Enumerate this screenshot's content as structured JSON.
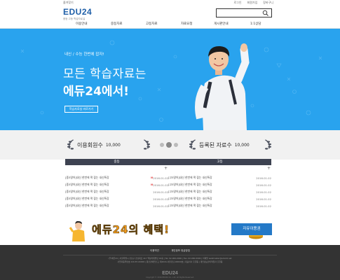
{
  "util": {
    "left": "즐겨찾기",
    "links": [
      "로그인",
      "회원가입",
      "장바구니"
    ]
  },
  "brand": {
    "logo": "EDU24",
    "tagline": "중등 고등 학습자료실",
    "accent": "#29a3ee",
    "dark": "#3d4251"
  },
  "search": {
    "placeholder": "",
    "icon": "search-icon"
  },
  "nav": {
    "items": [
      "이용안내",
      "중등자료",
      "고등자료",
      "자료요청",
      "게시판안내",
      "1:1상담"
    ]
  },
  "hero": {
    "tag": "내신 / 수능 한번에 잡자!",
    "line1": "모든 학습자료는",
    "line2": "에듀24에서!",
    "button": "학습자료실 바로가기"
  },
  "stats": {
    "members_label": "이용회원수",
    "members_value": "10,000",
    "docs_label": "등록된 자료수",
    "docs_value": "10,000"
  },
  "boards": {
    "left": {
      "title": "중등",
      "plus": "+",
      "rows": [
        {
          "title": "[중3영어]내신 한번에 꽉 잡는 내신특강",
          "new": true,
          "date": "2016.01.02"
        },
        {
          "title": "[중3영어]내신 한번에 꽉 잡는 내신특강",
          "new": true,
          "date": "2016.01.02"
        },
        {
          "title": "[중3영어]내신 한번에 꽉 잡는 내신특강",
          "new": false,
          "date": "2016.01.02"
        },
        {
          "title": "[중3영어]내신 한번에 꽉 잡는 내신특강",
          "new": false,
          "date": "2016.01.02"
        },
        {
          "title": "[중3영어]내신 한번에 꽉 잡는 내신특강",
          "new": false,
          "date": "2016.01.02"
        }
      ]
    },
    "right": {
      "title": "고등",
      "plus": "+",
      "rows": [
        {
          "title": "[고3영어]내신 한번에 꽉 잡는 내신특강",
          "new": false,
          "date": "2016.01.02"
        },
        {
          "title": "[고3영어]내신 한번에 꽉 잡는 내신특강",
          "new": false,
          "date": "2016.01.02"
        },
        {
          "title": "[고3영어]내신 한번에 꽉 잡는 내신특강",
          "new": false,
          "date": "2016.01.02"
        },
        {
          "title": "[고3영어]내신 한번에 꽉 잡는 내신특강",
          "new": false,
          "date": "2016.01.02"
        },
        {
          "title": "[고3영어]내신 한번에 꽉 잡는 내신특강",
          "new": false,
          "date": "2016.01.02"
        }
      ]
    }
  },
  "banner": {
    "text": "에듀24의 혜택!",
    "button": "자유이용권"
  },
  "footer": {
    "links": [
      "이용약관",
      "개인정보 취급방침"
    ],
    "info1": "(주)에듀24 | 서울특별시 강남구 강남대로 417 역삼타워빌딩 16층 | Tel. 02-000-0000 | Fax. 02-000-0000 | 이메일 webmaster@edu24.net",
    "info2": "사업자등록번호 220-87-00000 | 통신판매업신고 제2016-서울강남-00000호 | 대표이사 홍길동 | 개인정보관리책임자 홍길동",
    "logo": "EDU24",
    "copyright": "Copyright © 2016 EDU24 Co., Ltd. All Rights Reserved."
  }
}
